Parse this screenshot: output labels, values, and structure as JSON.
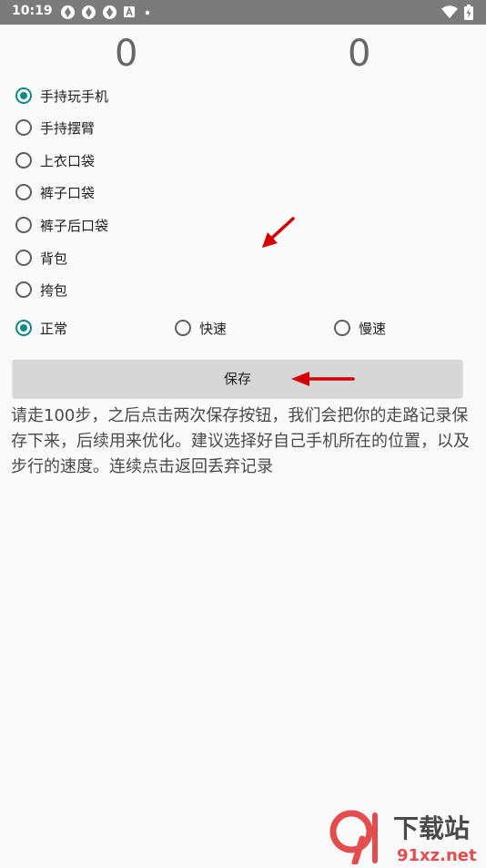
{
  "status_bar": {
    "time": "10:19"
  },
  "counters": {
    "left": "0",
    "right": "0"
  },
  "positions": [
    {
      "label": "手持玩手机",
      "checked": true
    },
    {
      "label": "手持摆臂",
      "checked": false
    },
    {
      "label": "上衣口袋",
      "checked": false
    },
    {
      "label": "裤子口袋",
      "checked": false
    },
    {
      "label": "裤子后口袋",
      "checked": false
    },
    {
      "label": "背包",
      "checked": false
    },
    {
      "label": "挎包",
      "checked": false
    }
  ],
  "speeds": [
    {
      "label": "正常",
      "checked": true
    },
    {
      "label": "快速",
      "checked": false
    },
    {
      "label": "慢速",
      "checked": false
    }
  ],
  "save_label": "保存",
  "hint": "请走100步，之后点击两次保存按钮，我们会把你的走路记录保存下来，后续用来优化。建议选择好自己手机所在的位置，以及步行的速度。连续点击返回丢弃记录",
  "watermark": {
    "title": "下载站",
    "url": "91xz.net"
  },
  "colors": {
    "accent": "#0f8a7f",
    "annotation": "#d40000"
  }
}
